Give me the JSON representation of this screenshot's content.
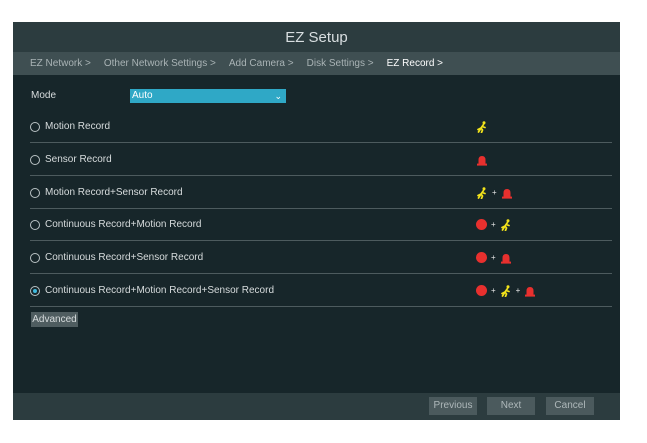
{
  "window": {
    "title": "EZ Setup"
  },
  "breadcrumb": [
    {
      "label": "EZ Network >"
    },
    {
      "label": "Other Network Settings >"
    },
    {
      "label": "Add Camera >"
    },
    {
      "label": "Disk Settings >"
    },
    {
      "label": "EZ Record >",
      "active": true
    }
  ],
  "mode": {
    "label": "Mode",
    "value": "Auto"
  },
  "options": [
    {
      "label": "Motion Record",
      "selected": false,
      "icons": [
        "motion-icon"
      ]
    },
    {
      "label": "Sensor Record",
      "selected": false,
      "icons": [
        "sensor-alarm-icon"
      ]
    },
    {
      "label": "Motion Record+Sensor Record",
      "selected": false,
      "icons": [
        "motion-icon",
        "sensor-alarm-icon"
      ]
    },
    {
      "label": "Continuous Record+Motion Record",
      "selected": false,
      "icons": [
        "continuous-record-icon",
        "motion-icon"
      ]
    },
    {
      "label": "Continuous Record+Sensor Record",
      "selected": false,
      "icons": [
        "continuous-record-icon",
        "sensor-alarm-icon"
      ]
    },
    {
      "label": "Continuous Record+Motion Record+Sensor Record",
      "selected": true,
      "icons": [
        "continuous-record-icon",
        "motion-icon",
        "sensor-alarm-icon"
      ]
    }
  ],
  "icon_plus": "+",
  "buttons": {
    "advanced": "Advanced",
    "previous": "Previous",
    "next": "Next",
    "cancel": "Cancel"
  },
  "colors": {
    "accent": "#2fa8c6",
    "motion": "#f2e31b",
    "alarm": "#e8302e",
    "background": "#17262a"
  }
}
